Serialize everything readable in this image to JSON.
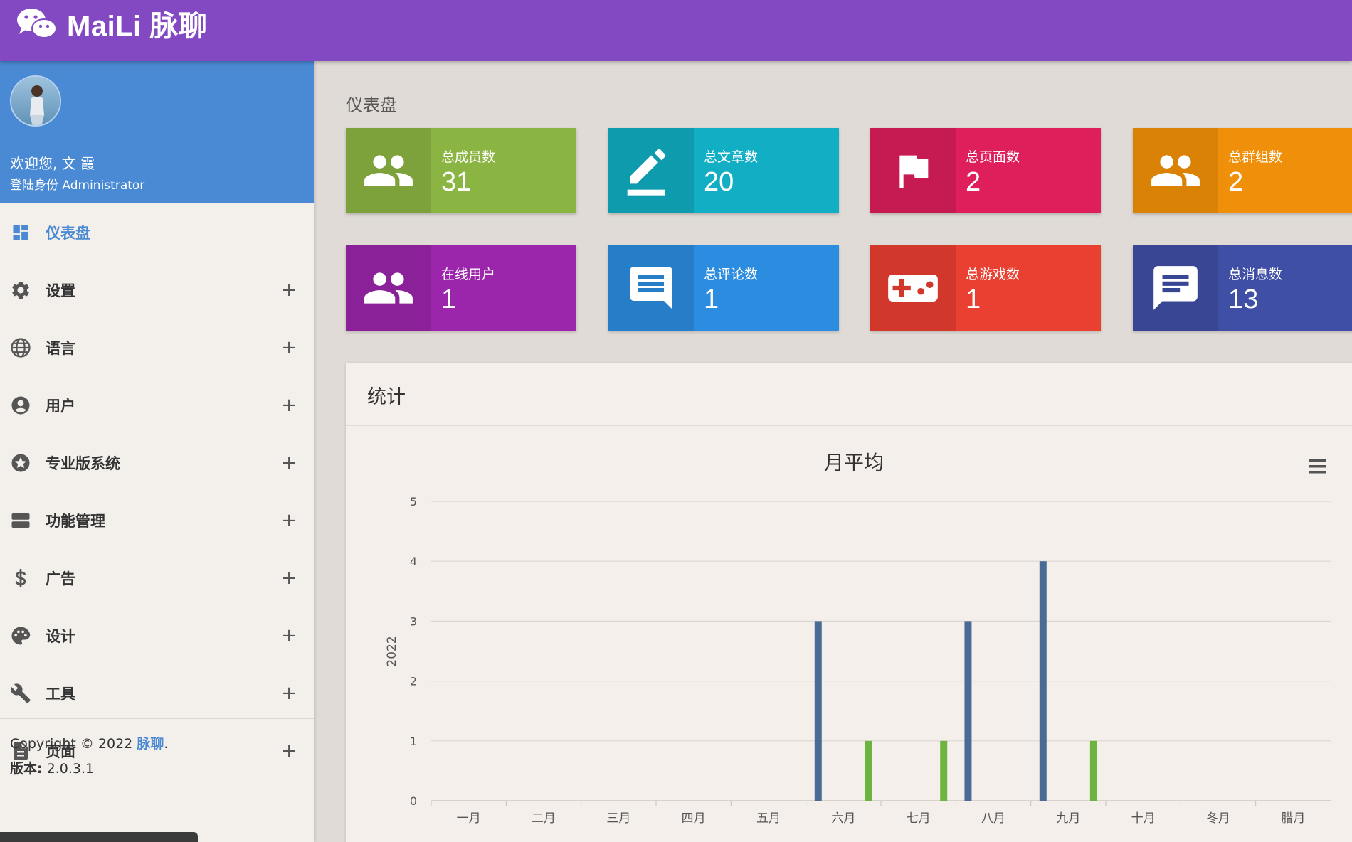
{
  "header": {
    "brand": "MaiLi 脉聊"
  },
  "user": {
    "welcome": "欢迎您, 文 霞",
    "role": "登陆身份 Administrator"
  },
  "sidebar": {
    "items": [
      {
        "label": "仪表盘",
        "icon": "dashboard-icon",
        "active": true
      },
      {
        "label": "设置",
        "icon": "gear-icon",
        "expand": "+"
      },
      {
        "label": "语言",
        "icon": "globe-icon",
        "expand": "+"
      },
      {
        "label": "用户",
        "icon": "user-circle-icon",
        "expand": "+"
      },
      {
        "label": "专业版系统",
        "icon": "star-circle-icon",
        "expand": "+"
      },
      {
        "label": "功能管理",
        "icon": "server-icon",
        "expand": "+"
      },
      {
        "label": "广告",
        "icon": "dollar-icon",
        "expand": "+"
      },
      {
        "label": "设计",
        "icon": "palette-icon",
        "expand": "+"
      },
      {
        "label": "工具",
        "icon": "wrench-icon",
        "expand": "+"
      },
      {
        "label": "页面",
        "icon": "page-icon",
        "expand": "+"
      }
    ],
    "footer": {
      "copyright": "Copyright © 2022 ",
      "link": "脉聊",
      "period": "."
    },
    "version_label": "版本:",
    "version_value": " 2.0.3.1"
  },
  "page": {
    "title": "仪表盘"
  },
  "cards": [
    {
      "label": "总成员数",
      "value": "31",
      "icon": "users-icon",
      "color": "#8bb543",
      "dark": "#7da23b"
    },
    {
      "label": "总文章数",
      "value": "20",
      "icon": "pencil-icon",
      "color": "#12aec4",
      "dark": "#0f9bae"
    },
    {
      "label": "总页面数",
      "value": "2",
      "icon": "flag-icon",
      "color": "#de1f5c",
      "dark": "#c61a52"
    },
    {
      "label": "总群组数",
      "value": "2",
      "icon": "users-icon",
      "color": "#f0900a",
      "dark": "#d98206"
    },
    {
      "label": "在线用户",
      "value": "1",
      "icon": "users-icon",
      "color": "#9b26ab",
      "dark": "#8b2198"
    },
    {
      "label": "总评论数",
      "value": "1",
      "icon": "comment-icon",
      "color": "#2c8ce0",
      "dark": "#267ec9"
    },
    {
      "label": "总游戏数",
      "value": "1",
      "icon": "gamepad-icon",
      "color": "#e94032",
      "dark": "#d1382b"
    },
    {
      "label": "总消息数",
      "value": "13",
      "icon": "message-icon",
      "color": "#3f4fa5",
      "dark": "#384694"
    }
  ],
  "stats_panel": {
    "title": "统计"
  },
  "chart_data": {
    "type": "bar",
    "title": "月平均",
    "ylabel": "2022",
    "ylim": [
      0,
      5
    ],
    "yticks": [
      "0",
      "1",
      "2",
      "3",
      "4",
      "5"
    ],
    "categories": [
      "一月",
      "二月",
      "三月",
      "四月",
      "五月",
      "六月",
      "七月",
      "八月",
      "九月",
      "十月",
      "冬月",
      "腊月"
    ],
    "series": [
      {
        "color": "#4a6c94",
        "values": [
          0,
          0,
          0,
          0,
          0,
          3,
          0,
          3,
          4,
          0,
          0,
          0
        ]
      },
      {
        "color": "#c73a35",
        "values": [
          0,
          0,
          0,
          0,
          0,
          0,
          0,
          0,
          0,
          0,
          0,
          0
        ]
      },
      {
        "color": "#e6a118",
        "values": [
          0,
          0,
          0,
          0,
          0,
          0,
          0,
          0,
          0,
          0,
          0,
          0
        ]
      },
      {
        "color": "#6db33f",
        "values": [
          0,
          0,
          0,
          0,
          0,
          1,
          1,
          0,
          1,
          0,
          0,
          0
        ]
      }
    ],
    "grid": true
  }
}
